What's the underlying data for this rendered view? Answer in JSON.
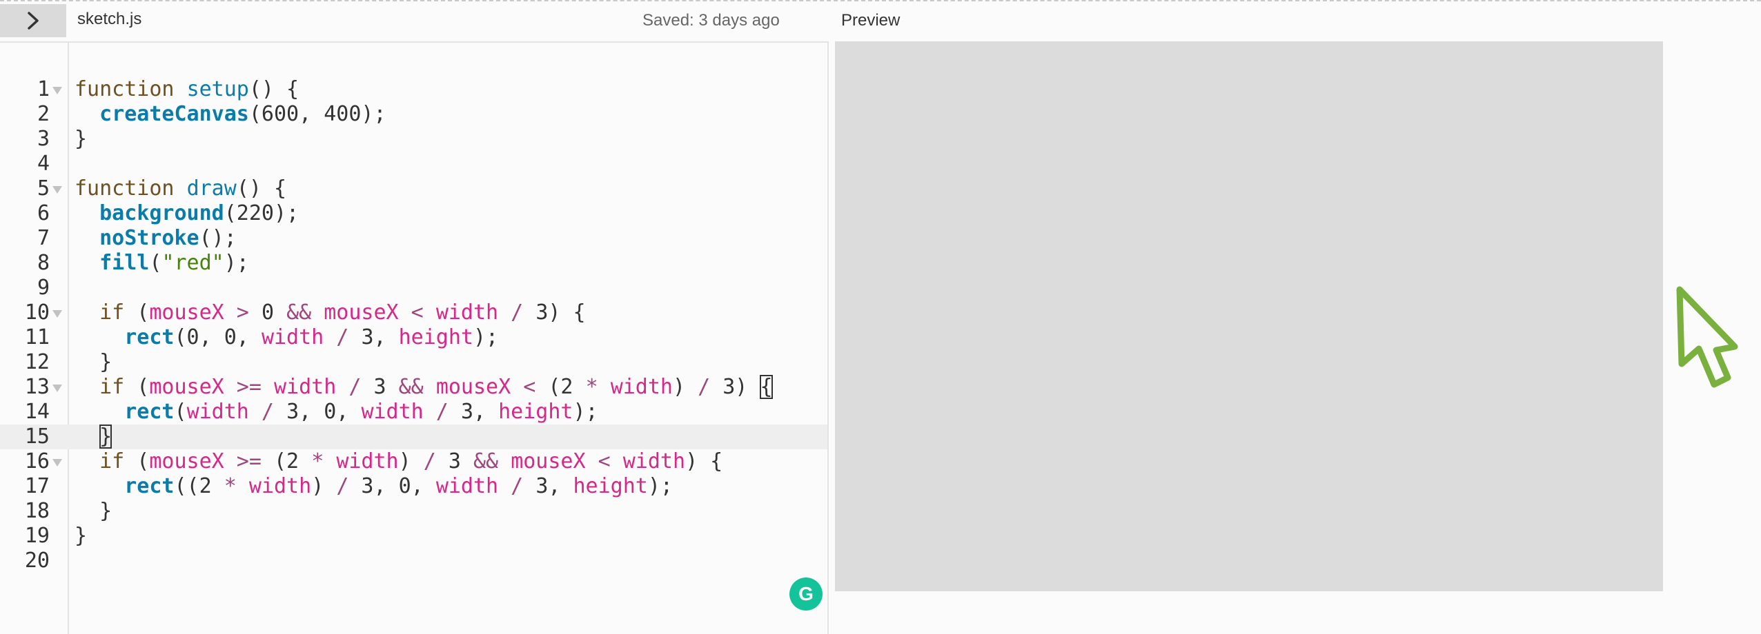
{
  "header": {
    "filename": "sketch.js",
    "saved_status": "Saved: 3 days ago",
    "preview_title": "Preview",
    "toggle_icon": "chevron-right-icon"
  },
  "editor": {
    "active_line": 15,
    "lines": [
      {
        "n": "1",
        "fold": true,
        "t": [
          [
            "kw",
            "function "
          ],
          [
            "fn",
            "setup"
          ],
          [
            "",
            "() {"
          ]
        ]
      },
      {
        "n": "2",
        "fold": false,
        "t": [
          [
            "",
            "  "
          ],
          [
            "bi",
            "createCanvas"
          ],
          [
            "",
            "(600, 400);"
          ]
        ]
      },
      {
        "n": "3",
        "fold": false,
        "t": [
          [
            "",
            "}"
          ]
        ]
      },
      {
        "n": "4",
        "fold": false,
        "t": []
      },
      {
        "n": "5",
        "fold": true,
        "t": [
          [
            "kw",
            "function "
          ],
          [
            "fn",
            "draw"
          ],
          [
            "",
            "() {"
          ]
        ]
      },
      {
        "n": "6",
        "fold": false,
        "t": [
          [
            "",
            "  "
          ],
          [
            "bi",
            "background"
          ],
          [
            "",
            "(220);"
          ]
        ]
      },
      {
        "n": "7",
        "fold": false,
        "t": [
          [
            "",
            "  "
          ],
          [
            "bi",
            "noStroke"
          ],
          [
            "",
            "();"
          ]
        ]
      },
      {
        "n": "8",
        "fold": false,
        "t": [
          [
            "",
            "  "
          ],
          [
            "bi",
            "fill"
          ],
          [
            "",
            "("
          ],
          [
            "st",
            "\"red\""
          ],
          [
            "",
            ");"
          ]
        ]
      },
      {
        "n": "9",
        "fold": false,
        "t": []
      },
      {
        "n": "10",
        "fold": true,
        "t": [
          [
            "",
            "  "
          ],
          [
            "kw",
            "if"
          ],
          [
            "",
            " ("
          ],
          [
            "va",
            "mouseX"
          ],
          [
            "op",
            " > "
          ],
          [
            "",
            "0 "
          ],
          [
            "op",
            "&&"
          ],
          [
            "",
            " "
          ],
          [
            "va",
            "mouseX"
          ],
          [
            "op",
            " < "
          ],
          [
            "va",
            "width"
          ],
          [
            "op",
            " / "
          ],
          [
            "",
            "3) {"
          ]
        ]
      },
      {
        "n": "11",
        "fold": false,
        "t": [
          [
            "",
            "    "
          ],
          [
            "bi",
            "rect"
          ],
          [
            "",
            "(0, 0, "
          ],
          [
            "va",
            "width"
          ],
          [
            "op",
            " / "
          ],
          [
            "",
            "3, "
          ],
          [
            "va",
            "height"
          ],
          [
            "",
            ");"
          ]
        ]
      },
      {
        "n": "12",
        "fold": false,
        "t": [
          [
            "",
            "  }"
          ]
        ]
      },
      {
        "n": "13",
        "fold": true,
        "t": [
          [
            "",
            "  "
          ],
          [
            "kw",
            "if"
          ],
          [
            "",
            " ("
          ],
          [
            "va",
            "mouseX"
          ],
          [
            "op",
            " >= "
          ],
          [
            "va",
            "width"
          ],
          [
            "op",
            " / "
          ],
          [
            "",
            "3 "
          ],
          [
            "op",
            "&&"
          ],
          [
            "",
            " "
          ],
          [
            "va",
            "mouseX"
          ],
          [
            "op",
            " < "
          ],
          [
            "",
            "(2 "
          ],
          [
            "op",
            "*"
          ],
          [
            "",
            " "
          ],
          [
            "va",
            "width"
          ],
          [
            "",
            ") "
          ],
          [
            "op",
            "/"
          ],
          [
            "",
            " 3) "
          ],
          [
            "bm",
            "{"
          ]
        ]
      },
      {
        "n": "14",
        "fold": false,
        "t": [
          [
            "",
            "    "
          ],
          [
            "bi",
            "rect"
          ],
          [
            "",
            "("
          ],
          [
            "va",
            "width"
          ],
          [
            "op",
            " / "
          ],
          [
            "",
            "3, 0, "
          ],
          [
            "va",
            "width"
          ],
          [
            "op",
            " / "
          ],
          [
            "",
            "3, "
          ],
          [
            "va",
            "height"
          ],
          [
            "",
            ");"
          ]
        ]
      },
      {
        "n": "15",
        "fold": false,
        "t": [
          [
            "",
            "  "
          ],
          [
            "bm",
            "}"
          ]
        ]
      },
      {
        "n": "16",
        "fold": true,
        "t": [
          [
            "",
            "  "
          ],
          [
            "kw",
            "if"
          ],
          [
            "",
            " ("
          ],
          [
            "va",
            "mouseX"
          ],
          [
            "op",
            " >= "
          ],
          [
            "",
            "(2 "
          ],
          [
            "op",
            "*"
          ],
          [
            "",
            " "
          ],
          [
            "va",
            "width"
          ],
          [
            "",
            ") "
          ],
          [
            "op",
            "/"
          ],
          [
            "",
            " 3 "
          ],
          [
            "op",
            "&&"
          ],
          [
            "",
            " "
          ],
          [
            "va",
            "mouseX"
          ],
          [
            "op",
            " < "
          ],
          [
            "va",
            "width"
          ],
          [
            "",
            ") {"
          ]
        ]
      },
      {
        "n": "17",
        "fold": false,
        "t": [
          [
            "",
            "    "
          ],
          [
            "bi",
            "rect"
          ],
          [
            "",
            "((2 "
          ],
          [
            "op",
            "*"
          ],
          [
            "",
            " "
          ],
          [
            "va",
            "width"
          ],
          [
            "",
            ") "
          ],
          [
            "op",
            "/"
          ],
          [
            "",
            " 3, 0, "
          ],
          [
            "va",
            "width"
          ],
          [
            "op",
            " / "
          ],
          [
            "",
            "3, "
          ],
          [
            "va",
            "height"
          ],
          [
            "",
            ");"
          ]
        ]
      },
      {
        "n": "18",
        "fold": false,
        "t": [
          [
            "",
            "  }"
          ]
        ]
      },
      {
        "n": "19",
        "fold": false,
        "t": [
          [
            "",
            "}"
          ]
        ]
      },
      {
        "n": "20",
        "fold": false,
        "t": []
      }
    ]
  },
  "grammarly": {
    "label": "G"
  },
  "colors": {
    "keyword": "#704f21",
    "function_name": "#0b7ca9",
    "variable": "#d52889",
    "string": "#47820a",
    "preview_bg": "#dcdcdc",
    "cursor_stroke": "#7ab03d"
  }
}
